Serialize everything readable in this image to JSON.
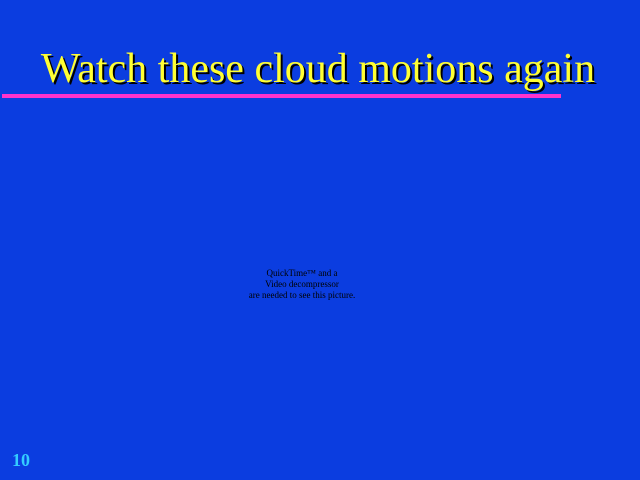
{
  "slide": {
    "title": "Watch these cloud motions again",
    "placeholder_lines": [
      "QuickTime™ and a",
      "Video decompressor",
      "are needed to see this picture."
    ],
    "slide_number": "10"
  },
  "colors": {
    "background": "#0b3de0",
    "title": "#ffff33",
    "title_rule": "#ff33cc",
    "slide_number": "#33ccff"
  }
}
